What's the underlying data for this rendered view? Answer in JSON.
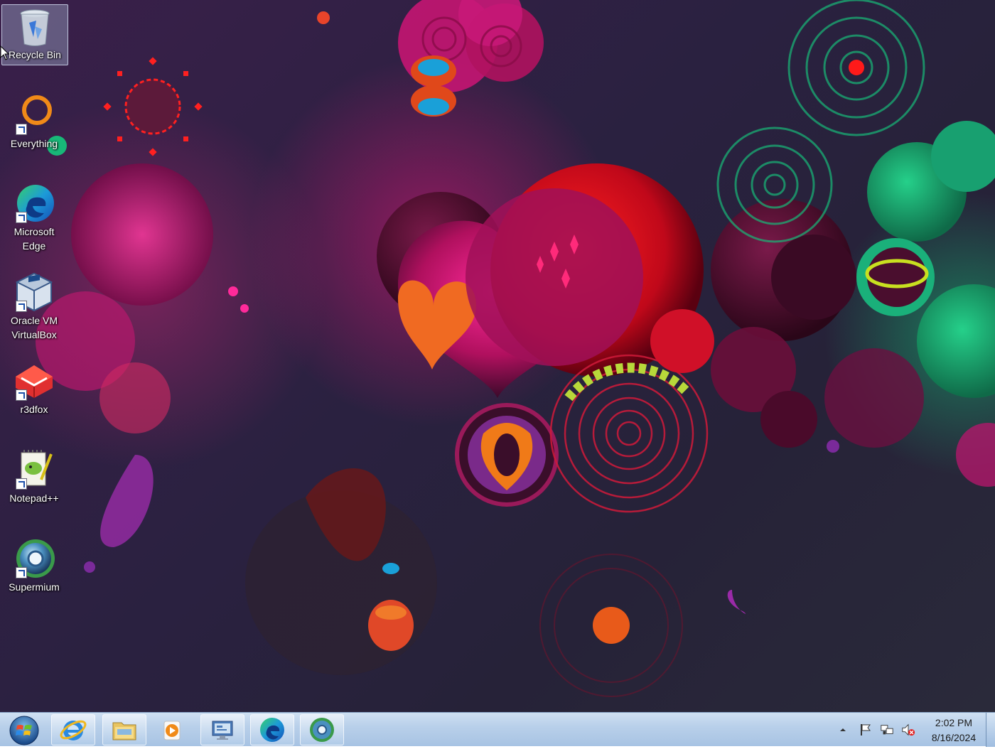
{
  "desktop": {
    "icons": [
      {
        "label": "Recycle Bin",
        "icon": "recycle-bin-icon",
        "selected": true
      },
      {
        "label": "Everything",
        "icon": "everything-icon"
      },
      {
        "label": "Microsoft\nEdge",
        "icon": "edge-icon"
      },
      {
        "label": "Oracle VM\nVirtualBox",
        "icon": "virtualbox-icon"
      },
      {
        "label": "r3dfox",
        "icon": "r3dfox-icon"
      },
      {
        "label": "Notepad++",
        "icon": "notepadpp-icon"
      },
      {
        "label": "Supermium",
        "icon": "supermium-icon"
      }
    ]
  },
  "taskbar": {
    "start": {
      "icon": "windows-start-icon"
    },
    "pinned": [
      {
        "name": "Internet Explorer",
        "icon": "internet-explorer-icon"
      },
      {
        "name": "Windows Explorer",
        "icon": "folder-explorer-icon"
      },
      {
        "name": "Windows Media Player",
        "icon": "media-player-icon"
      },
      {
        "name": "Remote Desktop",
        "icon": "remote-desktop-icon"
      },
      {
        "name": "Microsoft Edge",
        "icon": "edge-icon"
      },
      {
        "name": "Supermium",
        "icon": "supermium-icon"
      }
    ],
    "tray": {
      "icons": [
        "show-hidden-icons-arrow",
        "action-center-flag-icon",
        "network-icon",
        "volume-muted-icon"
      ],
      "time": "2:02 PM",
      "date": "8/16/2024"
    }
  },
  "colors": {
    "taskbar_top": "#cfe0f2",
    "taskbar_bottom": "#a7c3e3",
    "wallpaper_base": "#2a2140",
    "accent_magenta": "#e0147a",
    "accent_red": "#e01020",
    "accent_green": "#18b878"
  }
}
